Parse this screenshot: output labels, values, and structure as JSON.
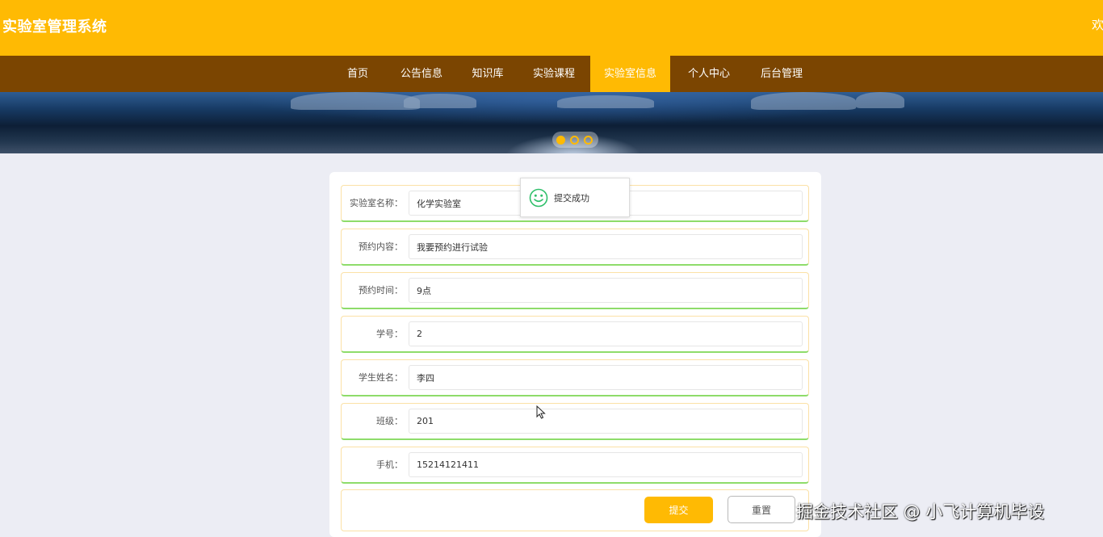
{
  "header": {
    "site_title": "实验室管理系统",
    "welcome_text": "欢"
  },
  "nav": {
    "items": [
      {
        "label": "首页"
      },
      {
        "label": "公告信息"
      },
      {
        "label": "知识库"
      },
      {
        "label": "实验课程"
      },
      {
        "label": "实验室信息",
        "active": true
      },
      {
        "label": "个人中心"
      },
      {
        "label": "后台管理"
      }
    ]
  },
  "banner": {
    "slide_count": 3,
    "active_slide": 1
  },
  "form": {
    "fields": [
      {
        "label": "实验室名称：",
        "value": "化学实验室"
      },
      {
        "label": "预约内容：",
        "value": "我要预约进行试验"
      },
      {
        "label": "预约时间：",
        "value": "9点"
      },
      {
        "label": "学号：",
        "value": "2"
      },
      {
        "label": "学生姓名：",
        "value": "李四"
      },
      {
        "label": "班级：",
        "value": "201"
      },
      {
        "label": "手机：",
        "value": "15214121411"
      }
    ],
    "submit_label": "提交",
    "reset_label": "重置"
  },
  "toast": {
    "icon": "smile-icon",
    "message": "提交成功"
  },
  "watermark": "掘金技术社区 @ 小飞计算机毕设",
  "colors": {
    "accent": "#ffba03",
    "nav_bg": "#7b4501",
    "page_bg": "#ecedf4",
    "success_green": "#8edc6a"
  }
}
